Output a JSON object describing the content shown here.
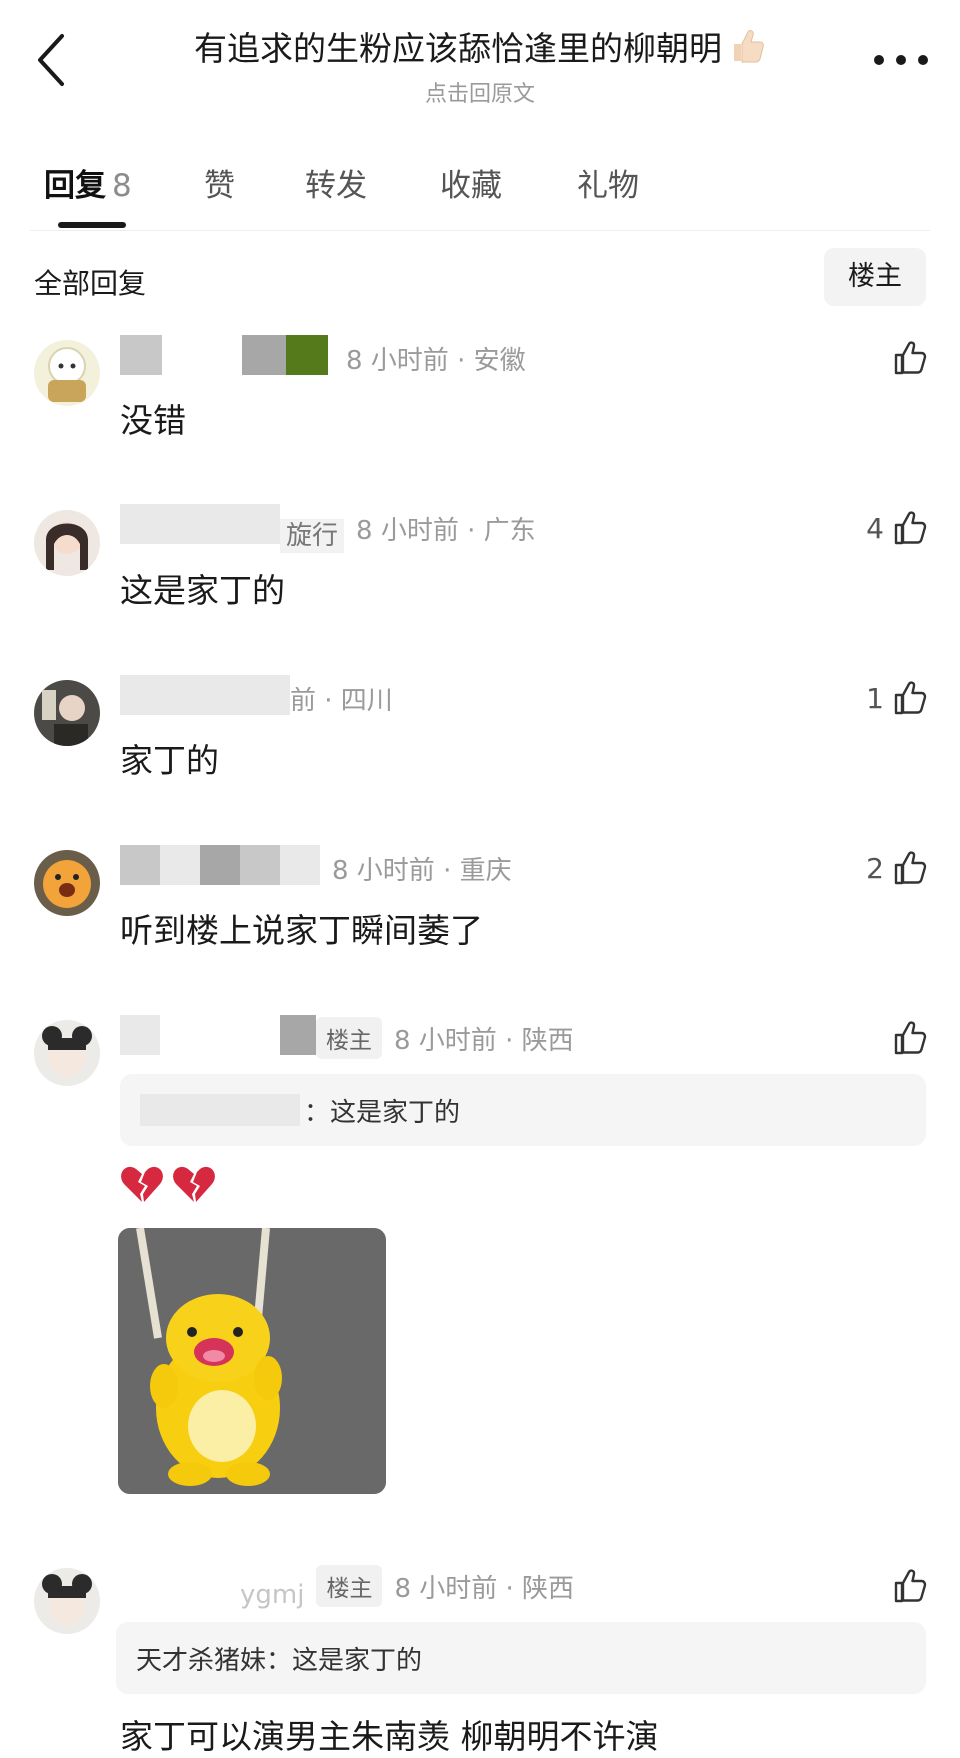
{
  "header": {
    "title": "有追求的生粉应该舔恰逢里的柳朝明",
    "subtitle": "点击回原文"
  },
  "tabs": [
    {
      "label": "回复",
      "count": "8"
    },
    {
      "label": "赞"
    },
    {
      "label": "转发"
    },
    {
      "label": "收藏"
    },
    {
      "label": "礼物"
    }
  ],
  "filter": {
    "label": "全部回复",
    "op_only_button": "楼主"
  },
  "comments": [
    {
      "meta": "8 小时前 · 安徽",
      "text": "没错"
    },
    {
      "username_fragment": "旋行",
      "meta": "8 小时前 · 广东",
      "likes": "4",
      "text": "这是家丁的"
    },
    {
      "meta": "前 · 四川",
      "likes": "1",
      "text": "家丁的"
    },
    {
      "meta": "8 小时前 · 重庆",
      "likes": "2",
      "text": "听到楼上说家丁瞬间萎了"
    },
    {
      "tag": "楼主",
      "meta": "8 小时前 · 陕西",
      "quote": "：这是家丁的",
      "emojis": "💔💔"
    },
    {
      "username_fragment": "ygmj",
      "tag": "楼主",
      "meta": "8 小时前 · 陕西",
      "quote": "天才杀猪妹：这是家丁的",
      "text": "家丁可以演男主朱南羡 柳朝明不许演"
    }
  ],
  "icons": {
    "back": "chevron-left-icon",
    "more": "more-dots-icon",
    "like": "thumb-up-icon"
  }
}
